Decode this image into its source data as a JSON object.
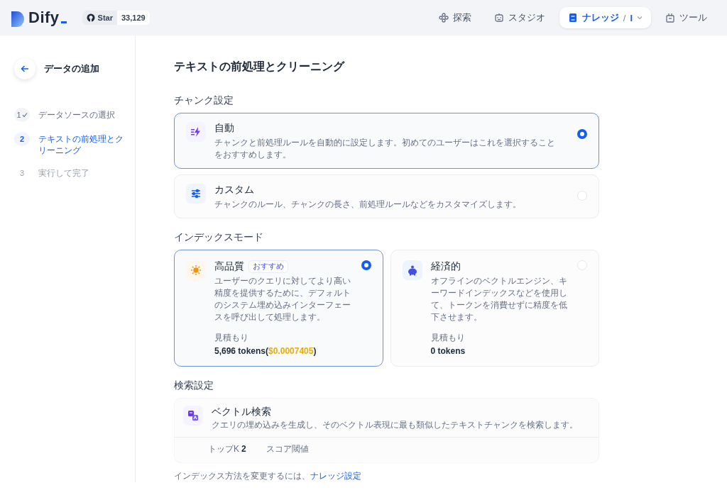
{
  "header": {
    "logo": "Dify",
    "github": {
      "label": "Star",
      "count": "33,129"
    },
    "nav": [
      {
        "label": "探索",
        "kind": "explore",
        "selected": false
      },
      {
        "label": "スタジオ",
        "kind": "studio",
        "selected": false
      },
      {
        "label": "ナレッジ",
        "kind": "knowledge",
        "selected": true,
        "separator": "/",
        "dataset": "I"
      },
      {
        "label": "ツール",
        "kind": "tools",
        "selected": false
      }
    ]
  },
  "sidebar": {
    "title": "データの追加",
    "steps": [
      {
        "number": "1",
        "label": "データソースの選択",
        "completed": true,
        "selected": false
      },
      {
        "number": "2",
        "label": "テキストの前処理とクリーニング",
        "completed": false,
        "selected": true
      },
      {
        "number": "3",
        "label": "実行して完了",
        "completed": false,
        "selected": false
      }
    ]
  },
  "main": {
    "title": "テキストの前処理とクリーニング",
    "chunk_settings": {
      "label": "チャンク設定",
      "options": [
        {
          "kind": "auto",
          "title": "自動",
          "description": "チャンクと前処理ルールを自動的に設定します。初めてのユーザーはこれを選択することをおすすめします。",
          "selected": true
        },
        {
          "kind": "custom",
          "title": "カスタム",
          "description": "チャンクのルール、チャンクの長さ、前処理ルールなどをカスタマイズします。",
          "selected": false
        }
      ]
    },
    "index_mode": {
      "label": "インデックスモード",
      "options": [
        {
          "kind": "quality",
          "title": "高品質",
          "badge": "おすすめ",
          "description": "ユーザーのクエリに対してより高い精度を提供するために、デフォルトのシステム埋め込みインターフェースを呼び出して処理します。",
          "estimate_label": "見積もり",
          "estimate": "5,696 tokens",
          "cost_prefix": "(",
          "cost": "$0.0007405",
          "cost_suffix": ")",
          "selected": true
        },
        {
          "kind": "economy",
          "title": "経済的",
          "description": "オフラインのベクトルエンジン、キーワードインデックスなどを使用して、トークンを消費せずに精度を低下させます。",
          "estimate_label": "見積もり",
          "estimate": "0 tokens",
          "selected": false
        }
      ]
    },
    "retrieval": {
      "label": "検索設定",
      "method": {
        "kind": "vector",
        "title": "ベクトル検索",
        "description": "クエリの埋め込みを生成し、そのベクトル表現に最も類似したテキストチャンクを検索します。"
      },
      "params": [
        {
          "label": "トップK",
          "value": "2"
        },
        {
          "label": "スコア閾値"
        }
      ]
    },
    "note": {
      "text": "インデックス方法を変更するには、",
      "link": "ナレッジ設定"
    }
  }
}
